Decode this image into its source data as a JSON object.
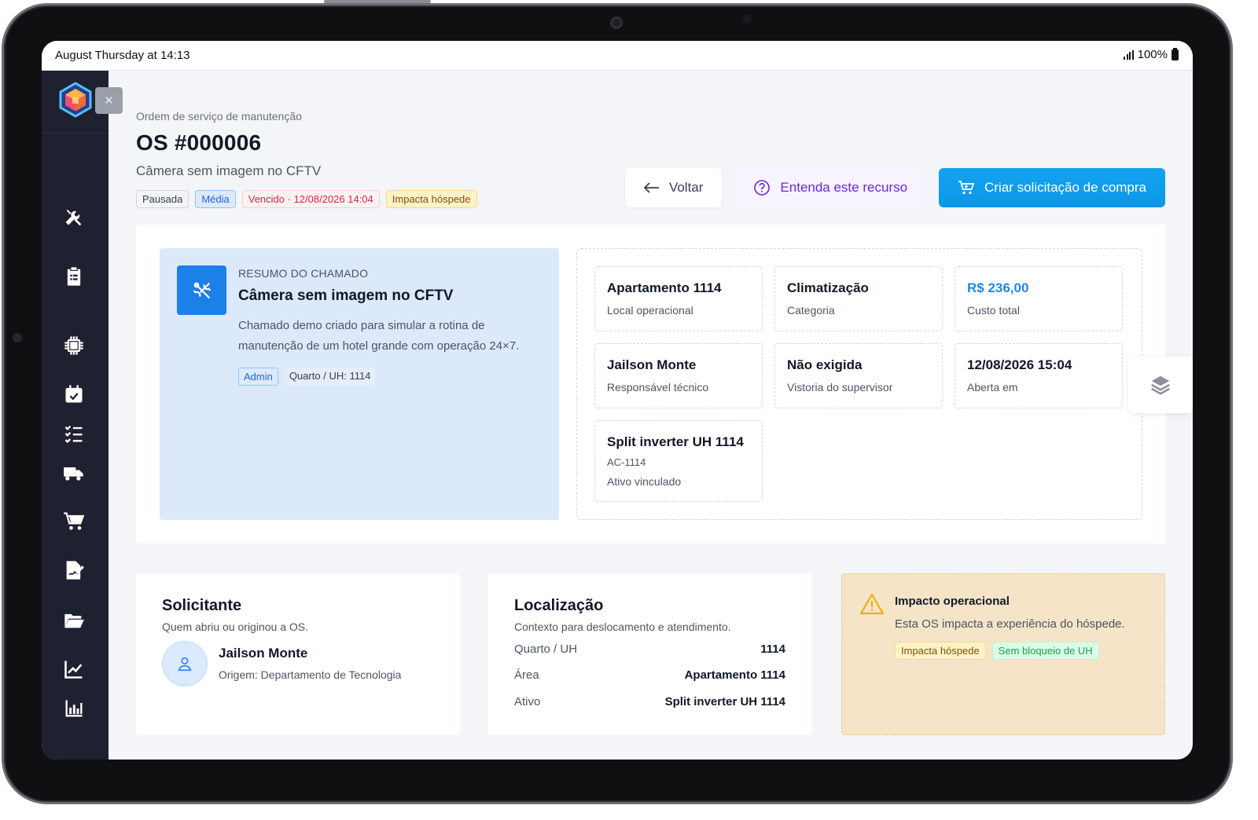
{
  "status_bar": {
    "time": "August Thursday at 14:13",
    "battery": "100%"
  },
  "sidebar": {
    "collapse_label": "✕",
    "items": [
      {
        "icon": "wrench-icon"
      },
      {
        "icon": "clipboard-icon"
      },
      {
        "icon": "chip-icon"
      },
      {
        "icon": "calendar-check-icon"
      },
      {
        "icon": "checklist-icon"
      },
      {
        "icon": "truck-icon"
      },
      {
        "icon": "cart-icon"
      },
      {
        "icon": "signature-icon"
      },
      {
        "icon": "folder-icon"
      },
      {
        "icon": "line-chart-icon"
      },
      {
        "icon": "bar-chart-icon"
      }
    ]
  },
  "header": {
    "eyebrow": "Ordem de serviço de manutenção",
    "title": "OS #000006",
    "subtitle": "Câmera sem imagem no CFTV",
    "badges": {
      "status": "Pausada",
      "priority": "Média",
      "due": "Vencido · 12/08/2026 14:04",
      "impact": "Impacta hóspede"
    }
  },
  "actions": {
    "back": "Voltar",
    "help": "Entenda este recurso",
    "purchase": "Criar solicitação de compra"
  },
  "summary": {
    "eyebrow": "RESUMO DO CHAMADO",
    "title": "Câmera sem imagem no CFTV",
    "description": "Chamado demo criado para simular a rotina de manutenção de um hotel grande com operação 24×7.",
    "tags": {
      "role": "Admin",
      "room": "Quarto / UH: 1114"
    }
  },
  "stats": {
    "local": {
      "value": "Apartamento 1114",
      "label": "Local operacional"
    },
    "category": {
      "value": "Climatização",
      "label": "Categoria"
    },
    "cost": {
      "value": "R$ 236,00",
      "label": "Custo total"
    },
    "tech": {
      "value": "Jailson Monte",
      "label": "Responsável técnico"
    },
    "inspection": {
      "value": "Não exigida",
      "label": "Vistoria do supervisor"
    },
    "opened": {
      "value": "12/08/2026 15:04",
      "label": "Aberta em"
    },
    "asset": {
      "value": "Split inverter UH 1114",
      "code": "AC-1114",
      "label": "Ativo vinculado"
    }
  },
  "requester": {
    "title": "Solicitante",
    "subtitle": "Quem abriu ou originou a OS.",
    "name": "Jailson Monte",
    "origin": "Origem: Departamento de Tecnologia"
  },
  "location": {
    "title": "Localização",
    "subtitle": "Contexto para deslocamento e atendimento.",
    "rows": [
      {
        "key": "Quarto / UH",
        "value": "1114"
      },
      {
        "key": "Área",
        "value": "Apartamento 1114"
      },
      {
        "key": "Ativo",
        "value": "Split inverter UH 1114"
      }
    ]
  },
  "impact": {
    "title": "Impacto operacional",
    "description": "Esta OS impacta a experiência do hóspede.",
    "tags": {
      "guest": "Impacta hóspede",
      "block": "Sem bloqueio de UH"
    }
  },
  "colors": {
    "accent": "#0ea5e9",
    "sidebar": "#1f2130",
    "summary_bg": "#dbe9fb",
    "impact_bg": "#f5e4c7"
  }
}
